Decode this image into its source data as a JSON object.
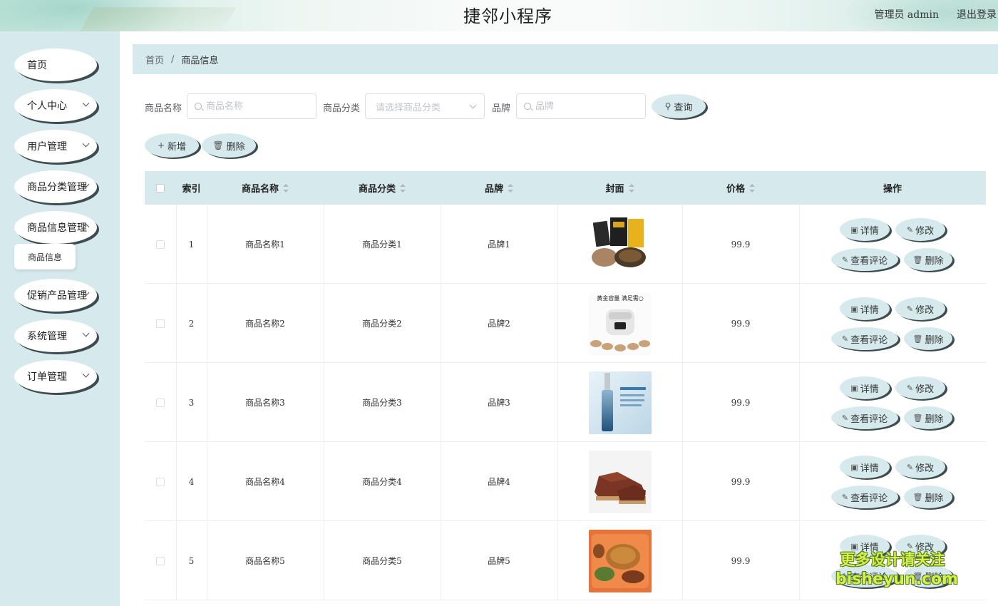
{
  "header": {
    "title": "捷邻小程序",
    "user_label": "管理员 admin",
    "logout_label": "退出登录"
  },
  "sidebar": {
    "items": [
      {
        "label": "首页",
        "has_arrow": false
      },
      {
        "label": "个人中心",
        "has_arrow": true
      },
      {
        "label": "用户管理",
        "has_arrow": true
      },
      {
        "label": "商品分类管理",
        "has_arrow": true
      },
      {
        "label": "商品信息管理",
        "has_arrow": true
      },
      {
        "label": "促销产品管理",
        "has_arrow": true
      },
      {
        "label": "系统管理",
        "has_arrow": true
      },
      {
        "label": "订单管理",
        "has_arrow": true
      }
    ],
    "submenu": {
      "label": "商品信息"
    }
  },
  "breadcrumb": {
    "home": "首页",
    "separator": "/",
    "current": "商品信息"
  },
  "search": {
    "name_label": "商品名称",
    "name_placeholder": "商品名称",
    "category_label": "商品分类",
    "category_placeholder": "请选择商品分类",
    "brand_label": "品牌",
    "brand_placeholder": "品牌",
    "query_button": "查询"
  },
  "actions": {
    "add_button": "新增",
    "delete_button": "删除"
  },
  "table": {
    "columns": [
      "索引",
      "商品名称",
      "商品分类",
      "品牌",
      "封面",
      "价格",
      "操作"
    ],
    "rows": [
      {
        "index": "1",
        "name": "商品名称1",
        "category": "商品分类1",
        "brand": "品牌1",
        "price": "99.9",
        "cover": "snack-bags-cover"
      },
      {
        "index": "2",
        "name": "商品名称2",
        "category": "商品分类2",
        "brand": "品牌2",
        "price": "99.9",
        "cover": "rice-cooker-cover"
      },
      {
        "index": "3",
        "name": "商品名称3",
        "category": "商品分类3",
        "brand": "品牌3",
        "price": "99.9",
        "cover": "serum-bottle-cover"
      },
      {
        "index": "4",
        "name": "商品名称4",
        "category": "商品分类4",
        "brand": "品牌4",
        "price": "99.9",
        "cover": "leather-shoe-cover"
      },
      {
        "index": "5",
        "name": "商品名称5",
        "category": "商品分类5",
        "brand": "品牌5",
        "price": "99.9",
        "cover": "fried-chicken-cover"
      }
    ],
    "row_actions": {
      "detail": "详情",
      "edit": "修改",
      "comments": "查看评论",
      "delete": "删除"
    }
  },
  "cover_texts": {
    "rice_cooker_slogan": "黄金容量 满足需○"
  },
  "watermark": {
    "line1": "更多设计请关注",
    "line2": "bisheyun.com"
  },
  "colors": {
    "accent": "#d6eaee",
    "shadow": "#3d4d4f",
    "watermark": "#d4f04a"
  }
}
